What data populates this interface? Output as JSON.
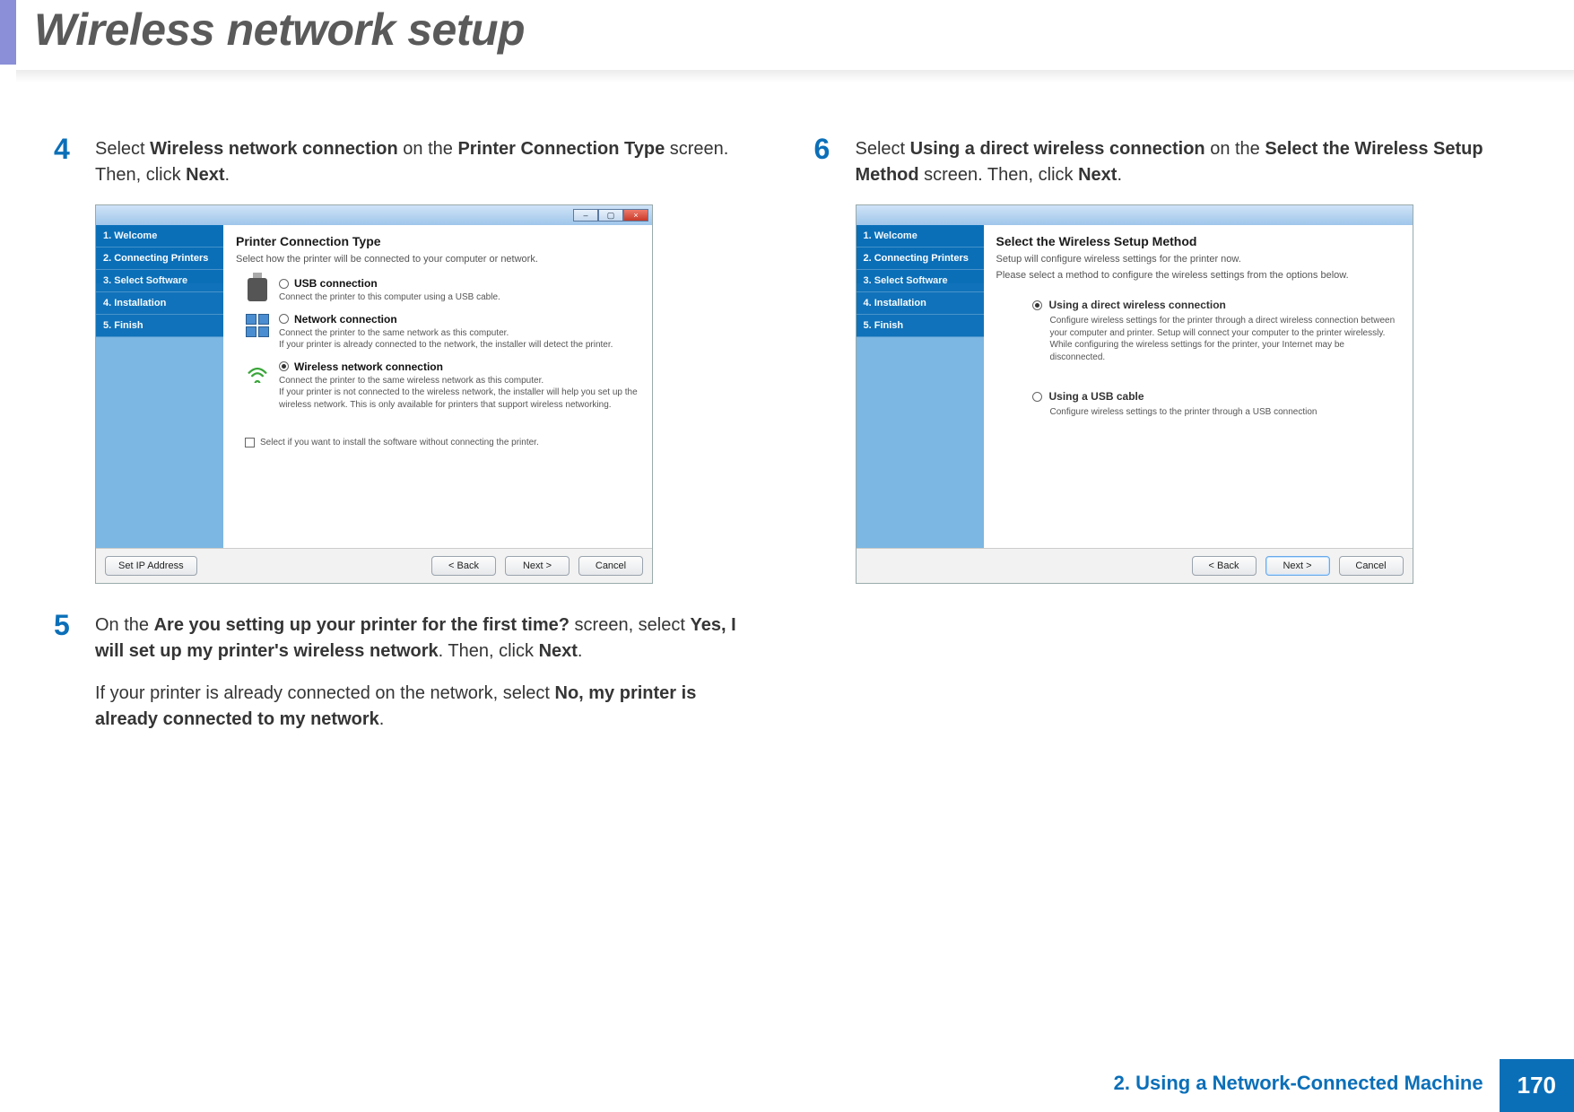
{
  "page": {
    "title": "Wireless network setup",
    "footer_chapter": "2.  Using a Network-Connected Machine",
    "footer_page": "170"
  },
  "step4": {
    "num": "4",
    "text_pre": "Select ",
    "bold1": "Wireless network connection",
    "text_mid1": " on the ",
    "bold2": "Printer Connection Type",
    "text_mid2": " screen. Then, click ",
    "bold3": "Next",
    "text_post": "."
  },
  "step5": {
    "num": "5",
    "line1_pre": "On the ",
    "line1_b1": "Are you setting up your printer for the first time?",
    "line1_mid": " screen, select ",
    "line1_b2": "Yes, I will set up my printer's wireless network",
    "line1_mid2": ". Then, click ",
    "line1_b3": "Next",
    "line1_post": ".",
    "line2_pre": "If your printer is already connected on the network, select ",
    "line2_b1": "No, my printer is already connected to my network",
    "line2_post": "."
  },
  "step6": {
    "num": "6",
    "text_pre": "Select ",
    "bold1": "Using a direct wireless connection",
    "text_mid1": " on the ",
    "bold2": "Select the Wireless Setup Method",
    "text_mid2": " screen. Then, click ",
    "bold3": "Next",
    "text_post": "."
  },
  "win_sidebar": {
    "i1": "1. Welcome",
    "i2": "2. Connecting Printers",
    "i3": "3. Select Software",
    "i4": "4. Installation",
    "i5": "5. Finish"
  },
  "win1": {
    "title": "Printer Connection Type",
    "sub": "Select how the printer will be connected to your computer or network.",
    "opt1_title": "USB connection",
    "opt1_desc": "Connect the printer to this computer using a USB cable.",
    "opt2_title": "Network connection",
    "opt2_desc": "Connect the printer to the same network as this computer.\nIf your printer is already connected to the network, the installer will detect the printer.",
    "opt3_title": "Wireless network connection",
    "opt3_desc": "Connect the printer to the same wireless network as this computer.\nIf your printer is not connected to the wireless network, the installer will help you set up the wireless network. This is only available for printers that support wireless networking.",
    "checkbox": "Select if you want to install the software without connecting the printer.",
    "btn_setip": "Set IP Address",
    "btn_back": "< Back",
    "btn_next": "Next >",
    "btn_cancel": "Cancel"
  },
  "win2": {
    "title": "Select the Wireless Setup Method",
    "sub1": "Setup will configure wireless settings for the printer now.",
    "sub2": "Please select a method to configure the wireless settings from the options below.",
    "opt1_title": "Using a direct wireless connection",
    "opt1_desc": "Configure wireless settings for the printer through a direct wireless connection between your computer and printer. Setup will connect your computer to the printer wirelessly.\nWhile configuring the wireless settings for the printer, your Internet may be disconnected.",
    "opt2_title": "Using a USB cable",
    "opt2_desc": "Configure wireless settings to the printer through a USB connection",
    "btn_back": "< Back",
    "btn_next": "Next >",
    "btn_cancel": "Cancel"
  }
}
